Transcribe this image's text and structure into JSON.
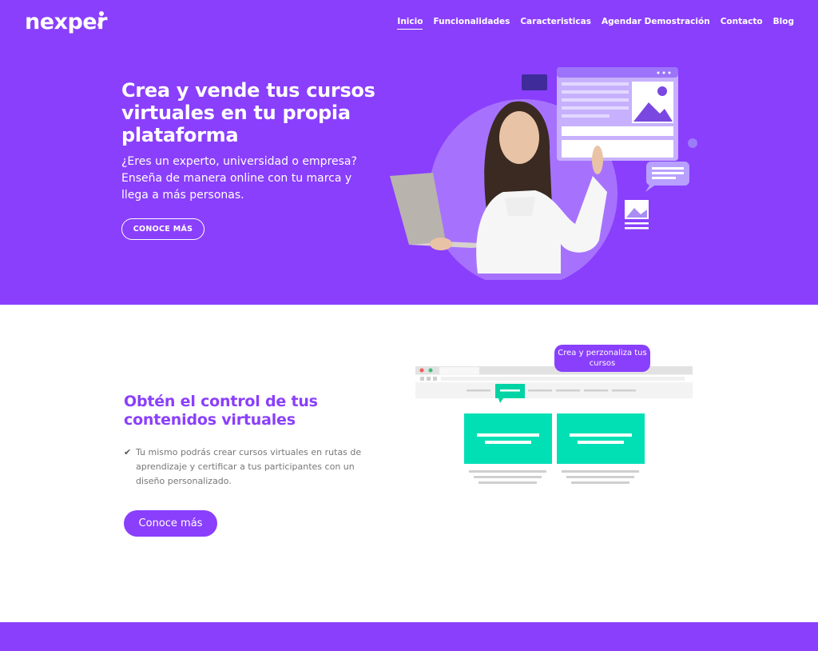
{
  "brand": {
    "logo": "nexper"
  },
  "nav": {
    "items": [
      {
        "label": "Inicio"
      },
      {
        "label": "Funcionalidades"
      },
      {
        "label": "Caracteristicas"
      },
      {
        "label": "Agendar Demostración"
      },
      {
        "label": "Contacto"
      },
      {
        "label": "Blog"
      }
    ]
  },
  "hero": {
    "title": "Crea y vende tus cursos virtuales en tu propia plataforma",
    "subtitle": "¿Eres un experto, universidad o empresa? Enseña de manera online con tu marca y llega a más personas.",
    "cta_label": "CONOCE MÁS"
  },
  "section2": {
    "title": "Obtén el control de tus contenidos virtuales",
    "check_icon": "check-icon",
    "bullet": "Tu mismo podrás crear cursos virtuales en rutas de aprendizaje y certificar a tus participantes con un diseño personalizado.",
    "cta_label": "Conoce más",
    "bubble": "Crea y perzonaliza tus cursos"
  },
  "colors": {
    "brand": "#8a3ffc",
    "accent": "#00e0b4",
    "white": "#ffffff"
  }
}
